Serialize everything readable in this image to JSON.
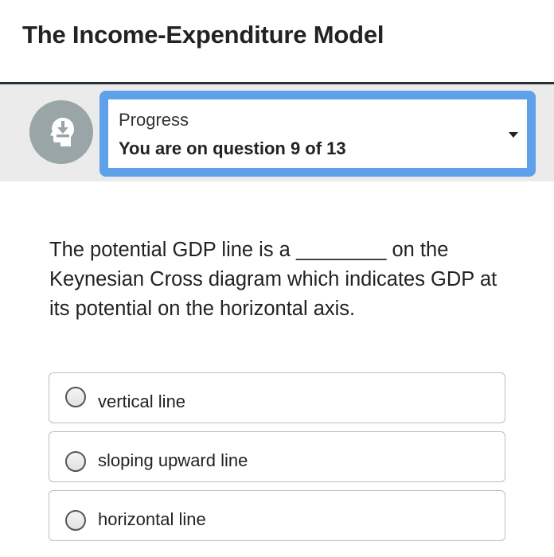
{
  "header": {
    "title": "The Income-Expenditure Model"
  },
  "progress": {
    "icon": "head-download-icon",
    "label": "Progress",
    "status": "You are on question 9 of 13"
  },
  "question": {
    "text": "The potential GDP line is a ________ on the Keynesian Cross diagram which indicates GDP at its potential on the horizontal axis."
  },
  "options": [
    {
      "label": "vertical line"
    },
    {
      "label": "sloping upward line"
    },
    {
      "label": "horizontal line"
    }
  ],
  "colors": {
    "accent": "#5fa0ea",
    "header_rule": "#263238",
    "band": "#ebebeb",
    "avatar": "#9aa5a8"
  }
}
